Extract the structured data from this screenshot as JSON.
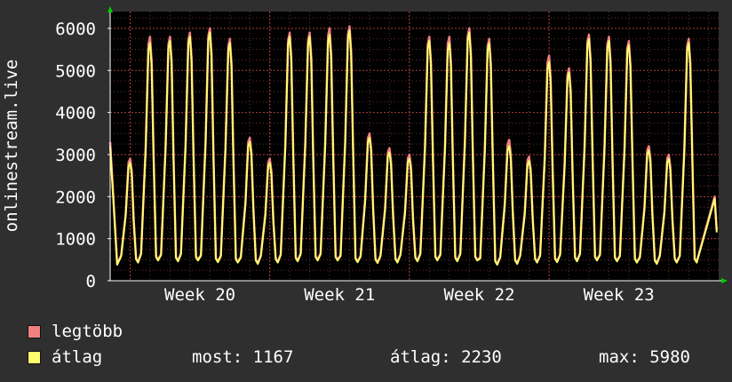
{
  "colors": {
    "background": "#2f2f2f",
    "plot_background": "#000000",
    "grid": "#8a3a3a",
    "axis": "#ffffff",
    "arrow": "#00cc00",
    "max_series": "#f08080",
    "avg_series": "#ffff70"
  },
  "legend": {
    "max_label": "legtöbb",
    "avg_label": "átlag",
    "now": "most: 1167",
    "average": "átlag: 2230",
    "maximum": "max: 5980"
  },
  "chart_data": {
    "type": "line",
    "ylabel": "onlinestream.live",
    "xlabel": "",
    "title": "",
    "ylim": [
      0,
      6400
    ],
    "yticks": [
      0,
      1000,
      2000,
      3000,
      4000,
      5000,
      6000
    ],
    "ytick_labels": [
      "0",
      "1000",
      "2000",
      "3000",
      "4000",
      "5000",
      "6000"
    ],
    "xlim_days": [
      0,
      30.5
    ],
    "xticks": [
      {
        "label": "Week 20",
        "day": 4.5
      },
      {
        "label": "Week 21",
        "day": 11.5
      },
      {
        "label": "Week 22",
        "day": 18.5
      },
      {
        "label": "Week 23",
        "day": 25.5
      }
    ],
    "grid": true,
    "legend_position": "bottom-left",
    "series": [
      {
        "name": "legtöbb",
        "daily_peaks": [
          2900,
          5800,
          5800,
          5900,
          6000,
          5750,
          3400,
          2900,
          5900,
          5900,
          6000,
          6050,
          3500,
          3150,
          3000,
          5800,
          5800,
          6000,
          5750,
          3350,
          2950,
          5350,
          5050,
          5850,
          5800,
          5700,
          3200,
          3000,
          5750
        ],
        "daily_troughs": [
          400,
          450,
          500,
          480,
          500,
          460,
          450,
          420,
          450,
          480,
          500,
          500,
          460,
          440,
          450,
          480,
          500,
          480,
          500,
          400,
          420,
          450,
          460,
          480,
          500,
          480,
          450,
          420,
          450
        ],
        "start": 3300,
        "end": 1200
      },
      {
        "name": "átlag",
        "daily_peaks": [
          2800,
          5650,
          5700,
          5800,
          5900,
          5650,
          3300,
          2800,
          5800,
          5800,
          5850,
          5950,
          3400,
          3050,
          2900,
          5700,
          5650,
          5900,
          5650,
          3200,
          2850,
          5200,
          4950,
          5750,
          5700,
          5600,
          3100,
          2900,
          5650
        ],
        "daily_troughs": [
          380,
          430,
          480,
          460,
          480,
          440,
          430,
          400,
          430,
          460,
          480,
          480,
          440,
          420,
          430,
          460,
          480,
          460,
          480,
          380,
          400,
          430,
          440,
          460,
          480,
          460,
          430,
          400,
          430
        ],
        "start": 3200,
        "end": 1150
      }
    ]
  }
}
